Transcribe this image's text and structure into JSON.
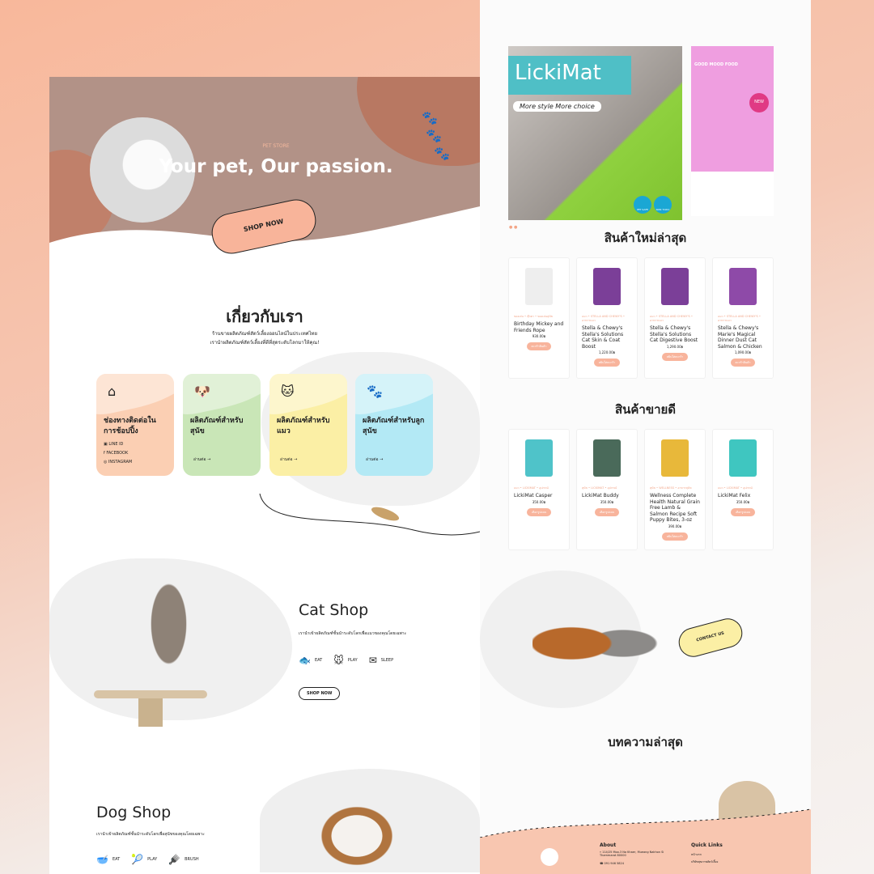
{
  "hero": {
    "eyebrow": "PET STORE",
    "title": "Your pet, Our passion.",
    "cta": "SHOP NOW"
  },
  "about": {
    "title": "เกี่ยวกับเรา",
    "line1": "ร้านขายผลิตภัณฑ์สัตว์เลี้ยงออนไลน์ในประเทศไทย",
    "line2": "เรานำผลิตภัณฑ์สัตว์เลี้ยงที่ดีที่สุดระดับโลกมาให้คุณ!",
    "cards": [
      {
        "title": "ช่องทางติดต่อในการช้อปปิ้ง",
        "links": [
          "LINE ID",
          "FACEBOOK",
          "INSTAGRAM"
        ],
        "color": "#fbcfb3"
      },
      {
        "title": "ผลิตภัณฑ์สำหรับสุนัข",
        "more": "อ่านต่อ",
        "color": "#c9e6b7"
      },
      {
        "title": "ผลิตภัณฑ์สำหรับแมว",
        "more": "อ่านต่อ",
        "color": "#fbefa5"
      },
      {
        "title": "ผลิตภัณฑ์สำหรับลูกสุนัข",
        "more": "อ่านต่อ",
        "color": "#b3e9f5"
      }
    ]
  },
  "cat_shop": {
    "title": "Cat Shop",
    "desc": "เรานำเข้าผลิตภัณฑ์ชั้นนำระดับโลกเพื่อแมวของคุณโดยเฉพาะ",
    "features": [
      "EAT",
      "PLAY",
      "SLEEP"
    ],
    "cta": "SHOP NOW"
  },
  "dog_shop": {
    "title": "Dog Shop",
    "desc": "เรานำเข้าผลิตภัณฑ์ชั้นนำระดับโลกเพื่อสุนัขของคุณโดยเฉพาะ",
    "features": [
      "EAT",
      "PLAY",
      "BRUSH"
    ]
  },
  "banner": {
    "brand": "LickiMat",
    "tagline": "More style More choice",
    "badge1": "PET SAFE",
    "badge2": "NON TOXIC",
    "side_brand": "GOOD MOOD FOOD",
    "side_badge": "NEW"
  },
  "new_products": {
    "title": "สินค้าใหม่ล่าสุด",
    "items": [
      {
        "cat": "ของเล่น • ตุ๊กตา • ของเล่นสุนัข",
        "name": "Birthday Mickey and Friends Rope",
        "price": "930.00฿",
        "btn": "ตะกร้าสินค้า",
        "color": "#eee"
      },
      {
        "cat": "แมว • STELLA AND CHEWY'S • อาหารแมว",
        "name": "Stella & Chewy's Stella's Solutions Cat Skin & Coat Boost",
        "price": "1,220.00฿",
        "btn": "หยิบใส่ตะกร้า",
        "color": "#7b3f98"
      },
      {
        "cat": "แมว • STELLA AND CHEWY'S • อาหารแมว",
        "name": "Stella & Chewy's Stella's Solutions Cat Digestive Boost",
        "price": "1,290.00฿",
        "btn": "หยิบใส่ตะกร้า",
        "color": "#7b3f98"
      },
      {
        "cat": "แมว • STELLA AND CHEWY'S • อาหารแมว",
        "name": "Stella & Chewy's Marie's Magical Dinner Dust Cat Salmon & Chicken",
        "price": "1,090.00฿",
        "btn": "ตะกร้าสินค้า",
        "color": "#8e4aa8"
      }
    ]
  },
  "best_sellers": {
    "title": "สินค้าขายดี",
    "items": [
      {
        "cat": "แมว • LICKIMAT • อุปกรณ์",
        "name": "LickiMat Casper",
        "price": "350.00฿",
        "btn": "เลือกรูปแบบ",
        "color": "#4fc3c9"
      },
      {
        "cat": "สุนัข • LICKIMAT • อุปกรณ์",
        "name": "LickiMat Buddy",
        "price": "350.00฿",
        "btn": "เลือกรูปแบบ",
        "color": "#4a6a5a"
      },
      {
        "cat": "สุนัข • WELLNESS • อาหารสุนัข",
        "name": "Wellness Complete Health Natural Grain Free Lamb & Salmon Recipe Soft Puppy Bites, 3-oz",
        "price": "390.00฿",
        "btn": "หยิบใส่ตะกร้า",
        "color": "#e8b83a"
      },
      {
        "cat": "แมว • LICKIMAT • อุปกรณ์",
        "name": "LickiMat Felix",
        "price": "350.00฿",
        "btn": "เลือกรูปแบบ",
        "color": "#3fc6c0"
      }
    ]
  },
  "contact": {
    "cta": "CONTACT US"
  },
  "articles": {
    "title": "บทความล่าสุด"
  },
  "footer": {
    "about_title": "About",
    "address": "114/25 Moo.3 Na Khaer, Mueang Nakhon Si Thammarat 80000",
    "phone": "091 946 5824",
    "links_title": "Quick Links",
    "links": [
      "หน้าแรก",
      "บริษัทสุขภาพสัตว์เลี้ยง"
    ]
  }
}
